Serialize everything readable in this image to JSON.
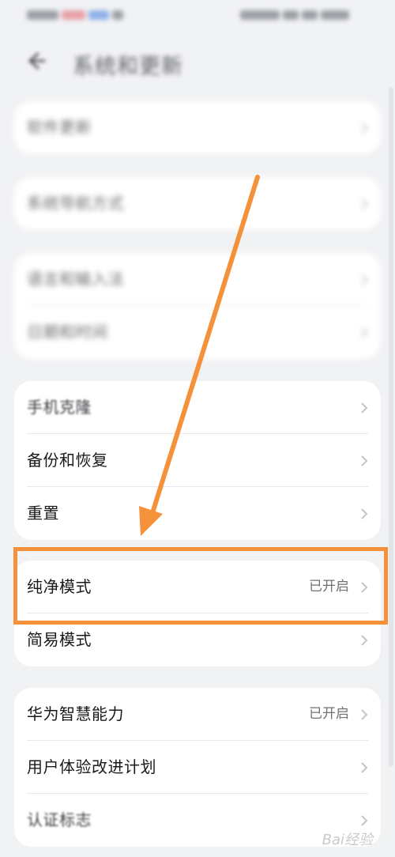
{
  "header": {
    "title": "系统和更新"
  },
  "groups": [
    {
      "rows": [
        {
          "label": "软件更新"
        }
      ]
    },
    {
      "rows": [
        {
          "label": "系统导航方式"
        }
      ]
    },
    {
      "rows": [
        {
          "label": "语言和输入法"
        },
        {
          "label": "日期和时间"
        }
      ]
    },
    {
      "rows": [
        {
          "label": "手机克隆"
        },
        {
          "label": "备份和恢复"
        },
        {
          "label": "重置"
        }
      ]
    },
    {
      "rows": [
        {
          "label": "纯净模式",
          "value": "已开启"
        },
        {
          "label": "简易模式"
        }
      ]
    },
    {
      "rows": [
        {
          "label": "华为智慧能力",
          "value": "已开启"
        },
        {
          "label": "用户体验改进计划"
        },
        {
          "label": "认证标志"
        }
      ]
    }
  ],
  "watermark": "Bai经验",
  "colors": {
    "accent": "#f5913b",
    "background": "#f1f2f4",
    "card": "#ffffff"
  }
}
